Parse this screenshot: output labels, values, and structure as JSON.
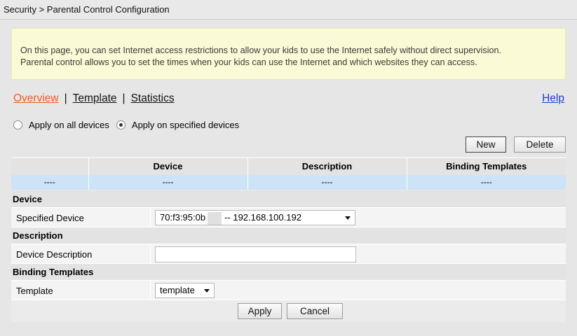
{
  "header": {
    "breadcrumb": "Security > Parental Control Configuration"
  },
  "notice": {
    "line1": "On this page, you can set Internet access restrictions to allow your kids to use the Internet safely without direct supervision.",
    "line2": "Parental control allows you to set the times when your kids can use the Internet and which websites they can access."
  },
  "nav": {
    "overview": "Overview",
    "separator": "|",
    "template": "Template",
    "statistics": "Statistics",
    "help": "Help"
  },
  "scope": {
    "all_devices": "Apply on all devices",
    "specified_devices": "Apply on specified devices",
    "selected": "specified_devices"
  },
  "toolbar": {
    "new_label": "New",
    "delete_label": "Delete"
  },
  "table": {
    "headers": [
      "",
      "Device",
      "Description",
      "Binding Templates"
    ],
    "rows": [
      [
        "----",
        "----",
        "----",
        "----"
      ]
    ]
  },
  "form": {
    "device_section": "Device",
    "specified_device_label": "Specified Device",
    "specified_device_value_prefix": "70:f3:95:0b",
    "specified_device_value_suffix": "--  192.168.100.192",
    "description_section": "Description",
    "device_description_label": "Device Description",
    "device_description_value": "",
    "binding_section": "Binding Templates",
    "template_label": "Template",
    "template_value": "template"
  },
  "actions": {
    "apply_label": "Apply",
    "cancel_label": "Cancel"
  },
  "colors": {
    "active_tab": "#f05a2a",
    "help_link": "#1a3fd6",
    "notice_bg": "#fbfad7",
    "table_row_bg": "#cde3f7"
  }
}
